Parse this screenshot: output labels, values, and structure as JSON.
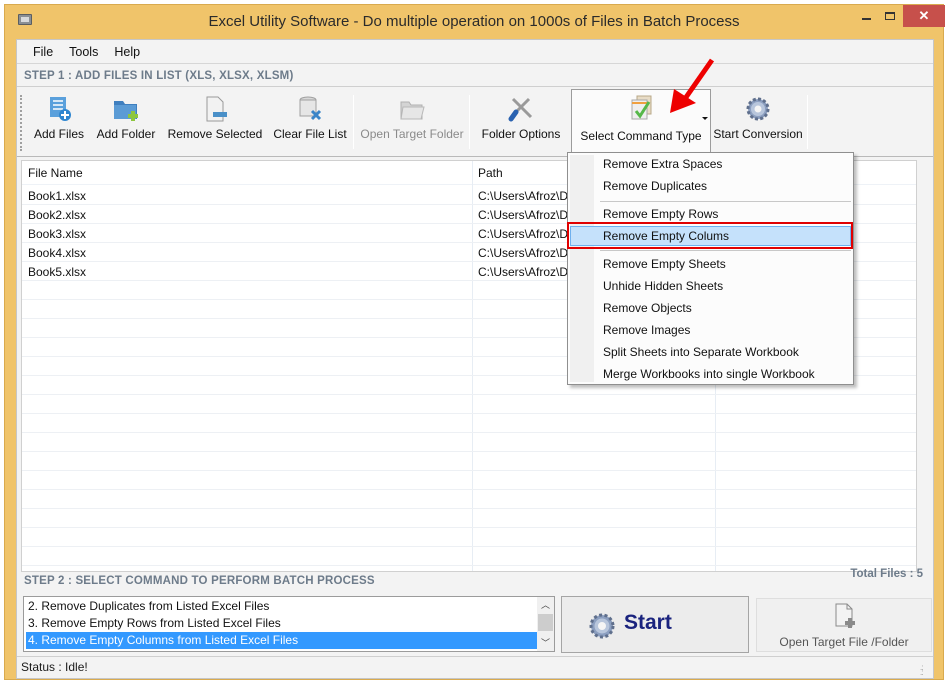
{
  "window": {
    "title": "Excel Utility Software - Do multiple operation on 1000s of Files in Batch Process",
    "controls": {
      "minimize": "–",
      "maximize": "□",
      "close": "✕"
    }
  },
  "menu": {
    "items": [
      {
        "label": "File"
      },
      {
        "label": "Tools"
      },
      {
        "label": "Help"
      }
    ]
  },
  "step1": {
    "label": "STEP 1 : ADD FILES IN LIST (XLS, XLSX, XLSM)"
  },
  "toolbar": {
    "buttons": [
      {
        "label": "Add Files",
        "icon": "add-files-icon",
        "enabled": true
      },
      {
        "label": "Add Folder",
        "icon": "add-folder-icon",
        "enabled": true
      },
      {
        "label": "Remove Selected",
        "icon": "remove-file-icon",
        "enabled": true
      },
      {
        "label": "Clear File List",
        "icon": "clear-list-icon",
        "enabled": true
      },
      {
        "label": "Open Target Folder",
        "icon": "open-folder-icon",
        "enabled": false
      },
      {
        "label": "Folder Options",
        "icon": "tools-icon",
        "enabled": true
      },
      {
        "label": "Select Command Type",
        "icon": "checklist-icon",
        "enabled": true,
        "active": true
      },
      {
        "label": "Start Conversion",
        "icon": "gear-icon",
        "enabled": true
      }
    ]
  },
  "file_grid": {
    "columns": [
      "File Name",
      "Path"
    ],
    "rows": [
      {
        "name": "Book1.xlsx",
        "path": "C:\\Users\\Afroz\\De"
      },
      {
        "name": "Book2.xlsx",
        "path": "C:\\Users\\Afroz\\De"
      },
      {
        "name": "Book3.xlsx",
        "path": "C:\\Users\\Afroz\\De"
      },
      {
        "name": "Book4.xlsx",
        "path": "C:\\Users\\Afroz\\De"
      },
      {
        "name": "Book5.xlsx",
        "path": "C:\\Users\\Afroz\\De"
      }
    ]
  },
  "command_menu": {
    "groups": [
      [
        "Remove Extra Spaces",
        "Remove Duplicates"
      ],
      [
        "Remove Empty Rows",
        "Remove Empty Colums"
      ],
      [
        "Remove Empty Sheets",
        "Unhide Hidden Sheets",
        "Remove Objects",
        "Remove Images",
        "Split Sheets into Separate Workbook",
        "Merge Workbooks into single Workbook"
      ]
    ],
    "highlighted": "Remove Empty Colums",
    "annotation_color": "#e00000"
  },
  "step2": {
    "label": "STEP 2 : SELECT COMMAND TO PERFORM BATCH PROCESS",
    "total_files": "Total Files : 5",
    "commands": [
      {
        "label": "2. Remove Duplicates from Listed Excel Files",
        "selected": false
      },
      {
        "label": "3. Remove Empty Rows from Listed Excel Files",
        "selected": false
      },
      {
        "label": "4. Remove Empty Columns from Listed Excel Files",
        "selected": true
      }
    ],
    "start_label": "Start",
    "open_target_label": "Open Target File /Folder"
  },
  "status": {
    "text": "Status  :  Idle!"
  },
  "colors": {
    "window_frame": "#f0c46a",
    "close_button": "#c7504b",
    "selection": "#3399ff",
    "menu_highlight": "#c5e1fb",
    "step_header": "#6d7b8a",
    "start_text": "#1a237e",
    "annotation": "#e00000"
  }
}
